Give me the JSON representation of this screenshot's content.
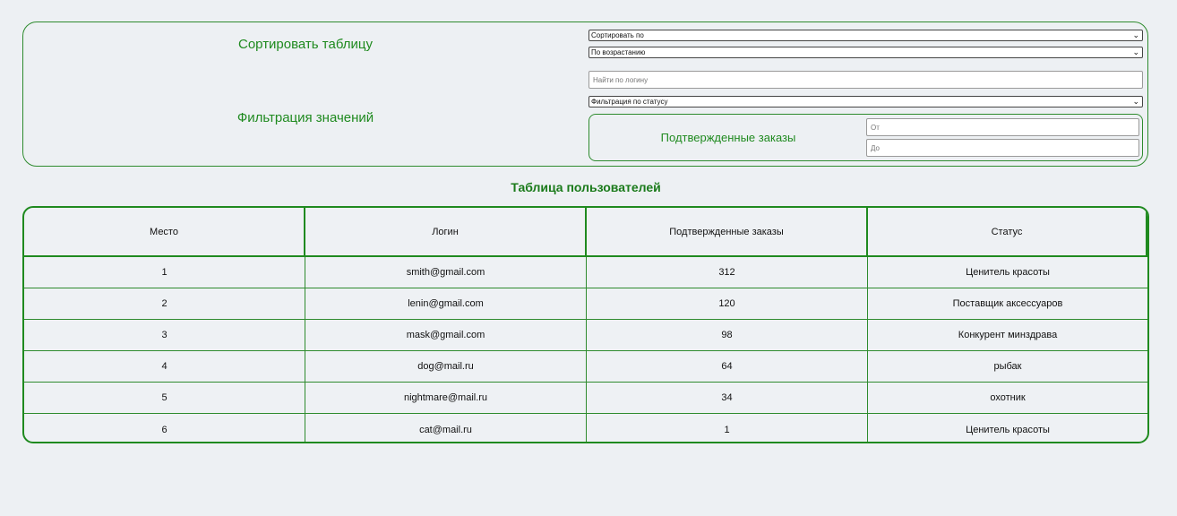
{
  "controls": {
    "sort_label": "Сортировать таблицу",
    "filter_label": "Фильтрация значений",
    "sort_by_select": "Сортировать по",
    "order_select": "По возрастанию",
    "login_search_placeholder": "Найти по логину",
    "status_filter_select": "Фильтрация по статусу",
    "confirmed_label": "Подтвержденные заказы",
    "from_placeholder": "От",
    "to_placeholder": "До"
  },
  "table": {
    "title": "Таблица пользователей",
    "headers": [
      "Место",
      "Логин",
      "Подтвержденные заказы",
      "Статус"
    ],
    "rows": [
      [
        "1",
        "smith@gmail.com",
        "312",
        "Ценитель красоты"
      ],
      [
        "2",
        "lenin@gmail.com",
        "120",
        "Поставщик аксессуаров"
      ],
      [
        "3",
        "mask@gmail.com",
        "98",
        "Конкурент минздрава"
      ],
      [
        "4",
        "dog@mail.ru",
        "64",
        "рыбак"
      ],
      [
        "5",
        "nightmare@mail.ru",
        "34",
        "охотник"
      ],
      [
        "6",
        "cat@mail.ru",
        "1",
        "Ценитель красоты"
      ]
    ]
  },
  "colors": {
    "accent": "#1f8a1f",
    "background": "#edf0f3"
  }
}
